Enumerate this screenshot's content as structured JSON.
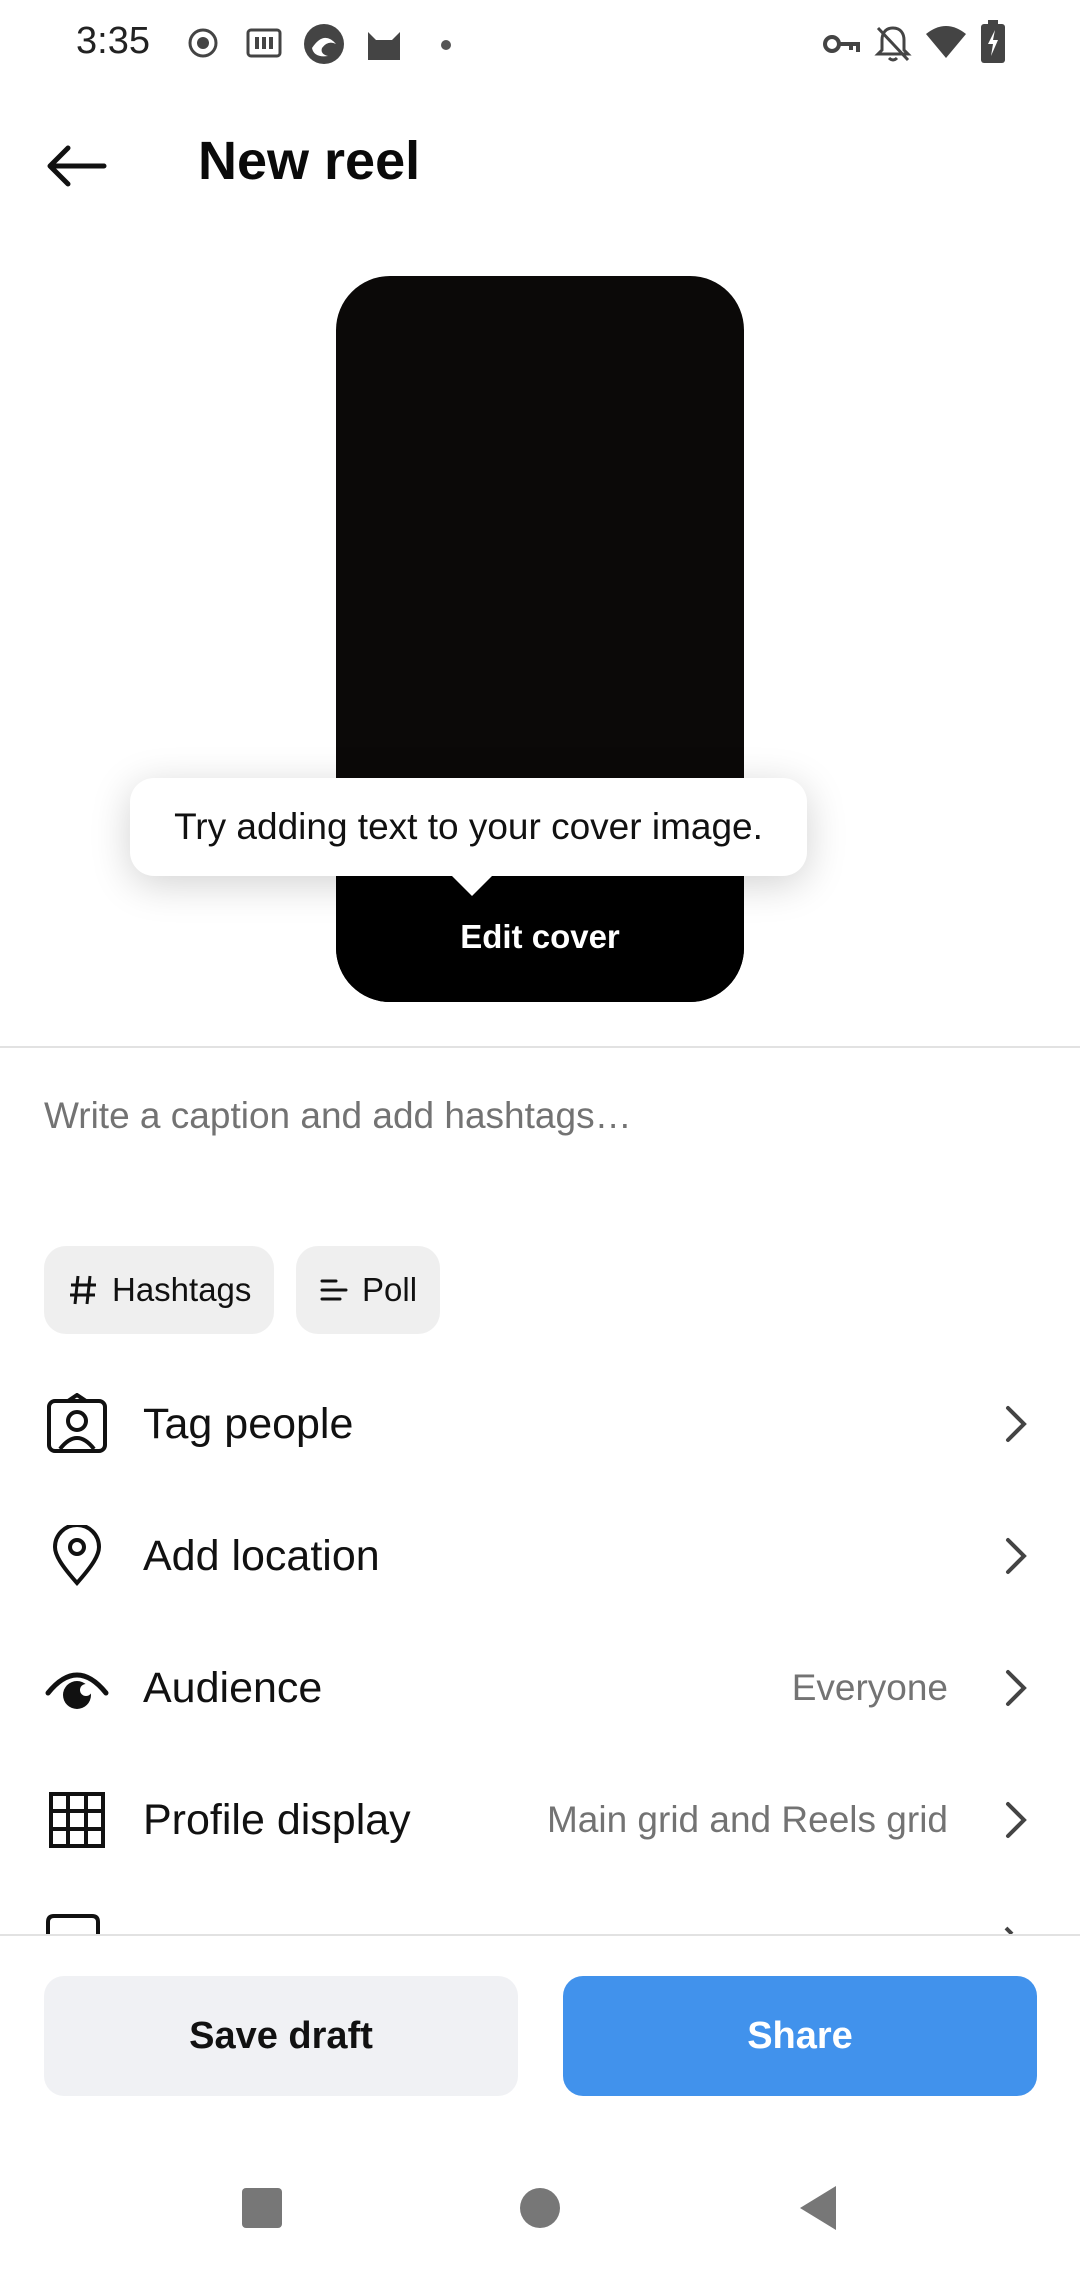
{
  "status_bar": {
    "time": "3:35",
    "left_icons": [
      "record-icon",
      "iqiyi-icon",
      "edge-icon",
      "cat-icon",
      "dot-icon"
    ],
    "right_icons": [
      "vpn-key-icon",
      "bell-off-icon",
      "wifi-icon",
      "battery-charging-icon"
    ]
  },
  "header": {
    "title": "New reel",
    "back_icon": "arrow-left-icon"
  },
  "cover": {
    "tooltip": "Try adding text to your cover image.",
    "edit_label": "Edit cover"
  },
  "caption": {
    "placeholder": "Write a caption and add hashtags…"
  },
  "chips": [
    {
      "label": "Hashtags",
      "icon": "hash-icon"
    },
    {
      "label": "Poll",
      "icon": "poll-icon"
    }
  ],
  "options": [
    {
      "label": "Tag people",
      "value": "",
      "icon": "tag-person-icon"
    },
    {
      "label": "Add location",
      "value": "",
      "icon": "location-pin-icon"
    },
    {
      "label": "Audience",
      "value": "Everyone",
      "icon": "eye-icon"
    },
    {
      "label": "Profile display",
      "value": "Main grid and Reels grid",
      "icon": "grid-icon"
    }
  ],
  "buttons": {
    "save_draft": "Save draft",
    "share": "Share"
  },
  "colors": {
    "share_blue": "#4192ec",
    "secondary_text": "#737373",
    "chip_bg": "#efefef"
  }
}
